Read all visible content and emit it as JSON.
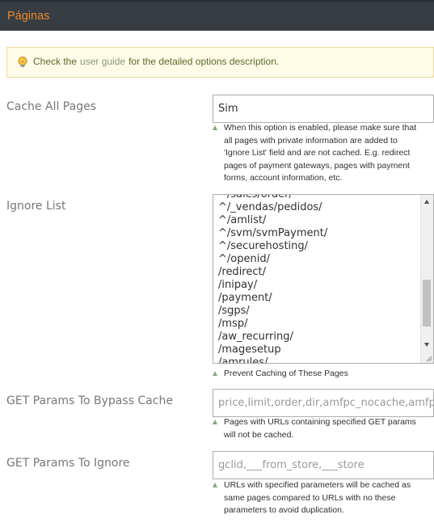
{
  "header": {
    "title": "Páginas"
  },
  "notice": {
    "icon": "lightbulb-icon",
    "text_before": "Check the",
    "link_text": "user guide",
    "text_after": "for the detailed options description."
  },
  "cache_all": {
    "label": "Cache All Pages",
    "value": "Sim",
    "note_lines": [
      "When this option is enabled, please make sure that",
      "all pages with private information are added to",
      "'Ignore List' field and are not cached. E.g. redirect",
      "pages of payment gateways, pages with payment",
      "forms, account information, etc."
    ]
  },
  "ignore_list": {
    "label": "Ignore List",
    "lines": [
      "^/sales/order/",
      "^/_vendas/pedidos/",
      "^/amlist/",
      "^/svm/svmPayment/",
      "^/securehosting/",
      "^/openid/",
      "/redirect/",
      "/inipay/",
      "/payment/",
      "/sgps/",
      "/msp/",
      "/aw_recurring/",
      "/magesetup",
      "/amrules/"
    ],
    "note": "Prevent Caching of These Pages"
  },
  "get_bypass": {
    "label": "GET Params To Bypass Cache",
    "value": "price,limit,order,dir,amfpc_nocache,amfpc_ajax",
    "note_lines": [
      "Pages with URLs containing specified GET params",
      "will not be cached."
    ]
  },
  "get_ignore": {
    "label": "GET Params To Ignore",
    "value": "gclid,___from_store,___store",
    "note_lines": [
      "URLs with specified parameters will be cached as",
      "same pages compared to URLs with no these",
      "parameters to avoid duplication."
    ]
  },
  "colors": {
    "header_bg": "#373d43",
    "header_title": "#eb8a28",
    "notice_bg": "#fffbe7",
    "note_arrow": "#8ba67a"
  }
}
